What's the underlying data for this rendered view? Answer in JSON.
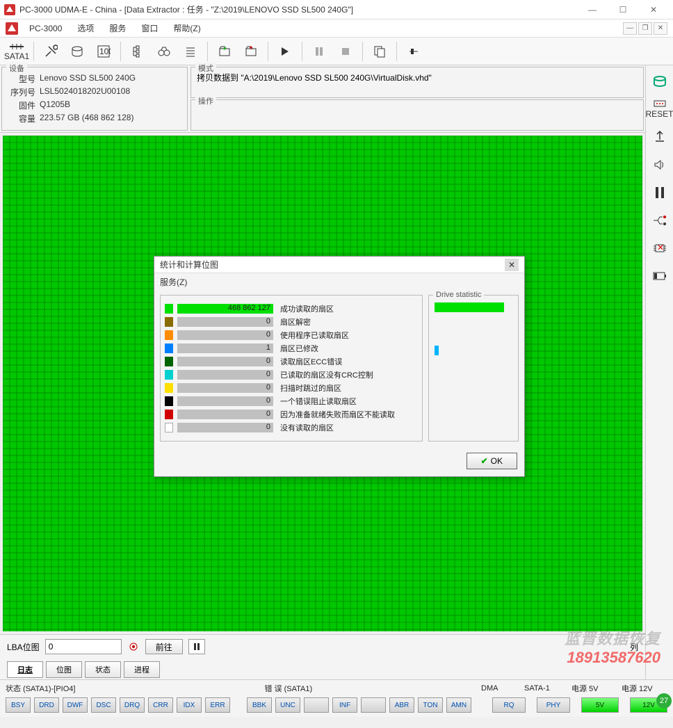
{
  "window": {
    "title": "PC-3000 UDMA-E - China - [Data Extractor : 任务 - \"Z:\\2019\\LENOVO SSD SL500 240G\"]"
  },
  "menubar": {
    "app_label": "PC-3000",
    "items": [
      "选项",
      "服务",
      "窗口",
      "帮助(Z)"
    ]
  },
  "toolbar": {
    "sata_label": "SATA1"
  },
  "device": {
    "legend": "设备",
    "rows": [
      {
        "label": "型号",
        "value": "Lenovo SSD SL500 240G"
      },
      {
        "label": "序列号",
        "value": "LSL5024018202U00108"
      },
      {
        "label": "固件",
        "value": "Q1205B"
      },
      {
        "label": "容量",
        "value": "223.57 GB (468 862 128)"
      }
    ]
  },
  "mode": {
    "legend": "模式",
    "text": "拷贝数据到 \"A:\\2019\\Lenovo SSD SL500 240G\\VirtualDisk.vhd\""
  },
  "operation": {
    "legend": "操作",
    "text": ""
  },
  "lba": {
    "label": "LBA位图",
    "value": "0",
    "go": "前往",
    "by_column": "列"
  },
  "tabs": [
    "日志",
    "位图",
    "状态",
    "进程"
  ],
  "active_tab": 0,
  "dialog": {
    "title": "统计和计算位图",
    "menu": "服务(Z)",
    "stats": [
      {
        "color": "#00e000",
        "value": "468 862 127",
        "desc": "成功读取的扇区",
        "full": true
      },
      {
        "color": "#8a6d00",
        "value": "0",
        "desc": "扇区解密",
        "full": false
      },
      {
        "color": "#ff8c00",
        "value": "0",
        "desc": "使用程序已读取扇区",
        "full": false
      },
      {
        "color": "#0080ff",
        "value": "1",
        "desc": "扇区已修改",
        "full": false
      },
      {
        "color": "#006400",
        "value": "0",
        "desc": "读取扇区ECC错误",
        "full": false
      },
      {
        "color": "#00d0d0",
        "value": "0",
        "desc": "已读取的扇区没有CRC控制",
        "full": false
      },
      {
        "color": "#ffe000",
        "value": "0",
        "desc": "扫描时跳过的扇区",
        "full": false
      },
      {
        "color": "#000000",
        "value": "0",
        "desc": "一个错误阻止读取扇区",
        "full": false
      },
      {
        "color": "#d00000",
        "value": "0",
        "desc": "因为准备就绪失败而扇区不能读取",
        "full": false
      },
      {
        "color": "#ffffff",
        "value": "0",
        "desc": "没有读取的扇区",
        "full": false
      }
    ],
    "drive_legend": "Drive statistic",
    "ok": "OK"
  },
  "statusbar": {
    "status_label": "状态 (SATA1)-[PIO4]",
    "error_label": "错 误 (SATA1)",
    "dma_label": "DMA",
    "sata_label": "SATA-1",
    "p5v_label": "电源 5V",
    "p12v_label": "电源 12V",
    "status_btns": [
      "BSY",
      "DRD",
      "DWF",
      "DSC",
      "DRQ",
      "CRR",
      "IDX",
      "ERR"
    ],
    "error_btns": [
      "BBK",
      "UNC",
      "",
      "INF",
      "",
      "ABR",
      "TON",
      "AMN"
    ],
    "dma_btn": "RQ",
    "sata_btn": "PHY",
    "p5v_btn": "5V",
    "p12v_btn": "12V",
    "badge": "27"
  },
  "sidebar_labels": {
    "reset": "RESET"
  },
  "watermark": {
    "line1": "蓝晋数据恢复",
    "line2": "18913587620"
  }
}
